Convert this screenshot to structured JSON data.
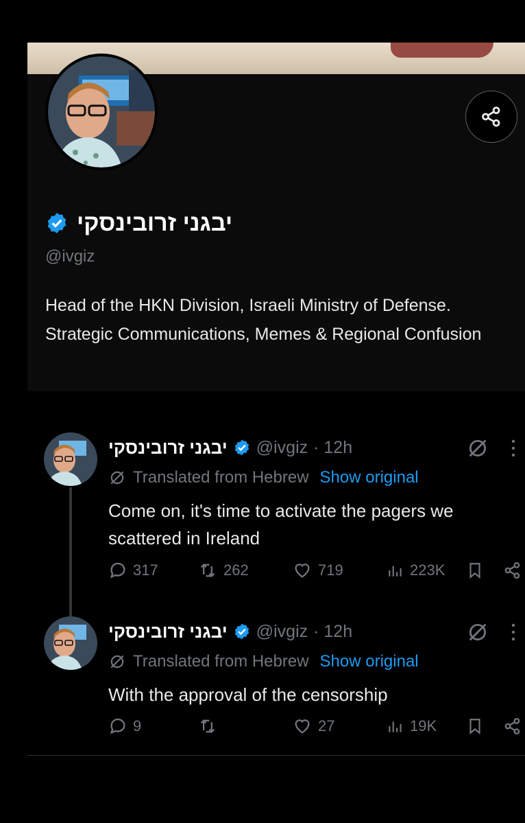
{
  "profile": {
    "display_name": "יבגני זרובינסקי",
    "handle": "@ivgiz",
    "bio": "Head of the HKN Division, Israeli Ministry of Defense. Strategic Communications, Memes & Regional Confusion",
    "verified": true
  },
  "tweets": [
    {
      "author": "יבגני זרובינסקי",
      "handle": "@ivgiz",
      "time": "· 12h",
      "translated_label": "Translated from Hebrew",
      "show_original": "Show original",
      "text": "Come on, it's time to activate the pagers we scattered in Ireland",
      "replies": "317",
      "reposts": "262",
      "likes": "719",
      "views": "223K"
    },
    {
      "author": "יבגני זרובינסקי",
      "handle": "@ivgiz",
      "time": "· 12h",
      "translated_label": "Translated from Hebrew",
      "show_original": "Show original",
      "text": "With the approval of the censorship",
      "replies": "9",
      "reposts": "",
      "likes": "27",
      "views": "19K"
    }
  ],
  "colors": {
    "accent": "#1d9bf0",
    "background": "#000000",
    "muted": "#71767b",
    "text": "#e7e9ea"
  },
  "icons": [
    "share-icon",
    "verified-badge-icon",
    "grok-icon",
    "more-icon",
    "translate-icon",
    "reply-icon",
    "repost-icon",
    "like-icon",
    "views-icon",
    "bookmark-icon"
  ]
}
